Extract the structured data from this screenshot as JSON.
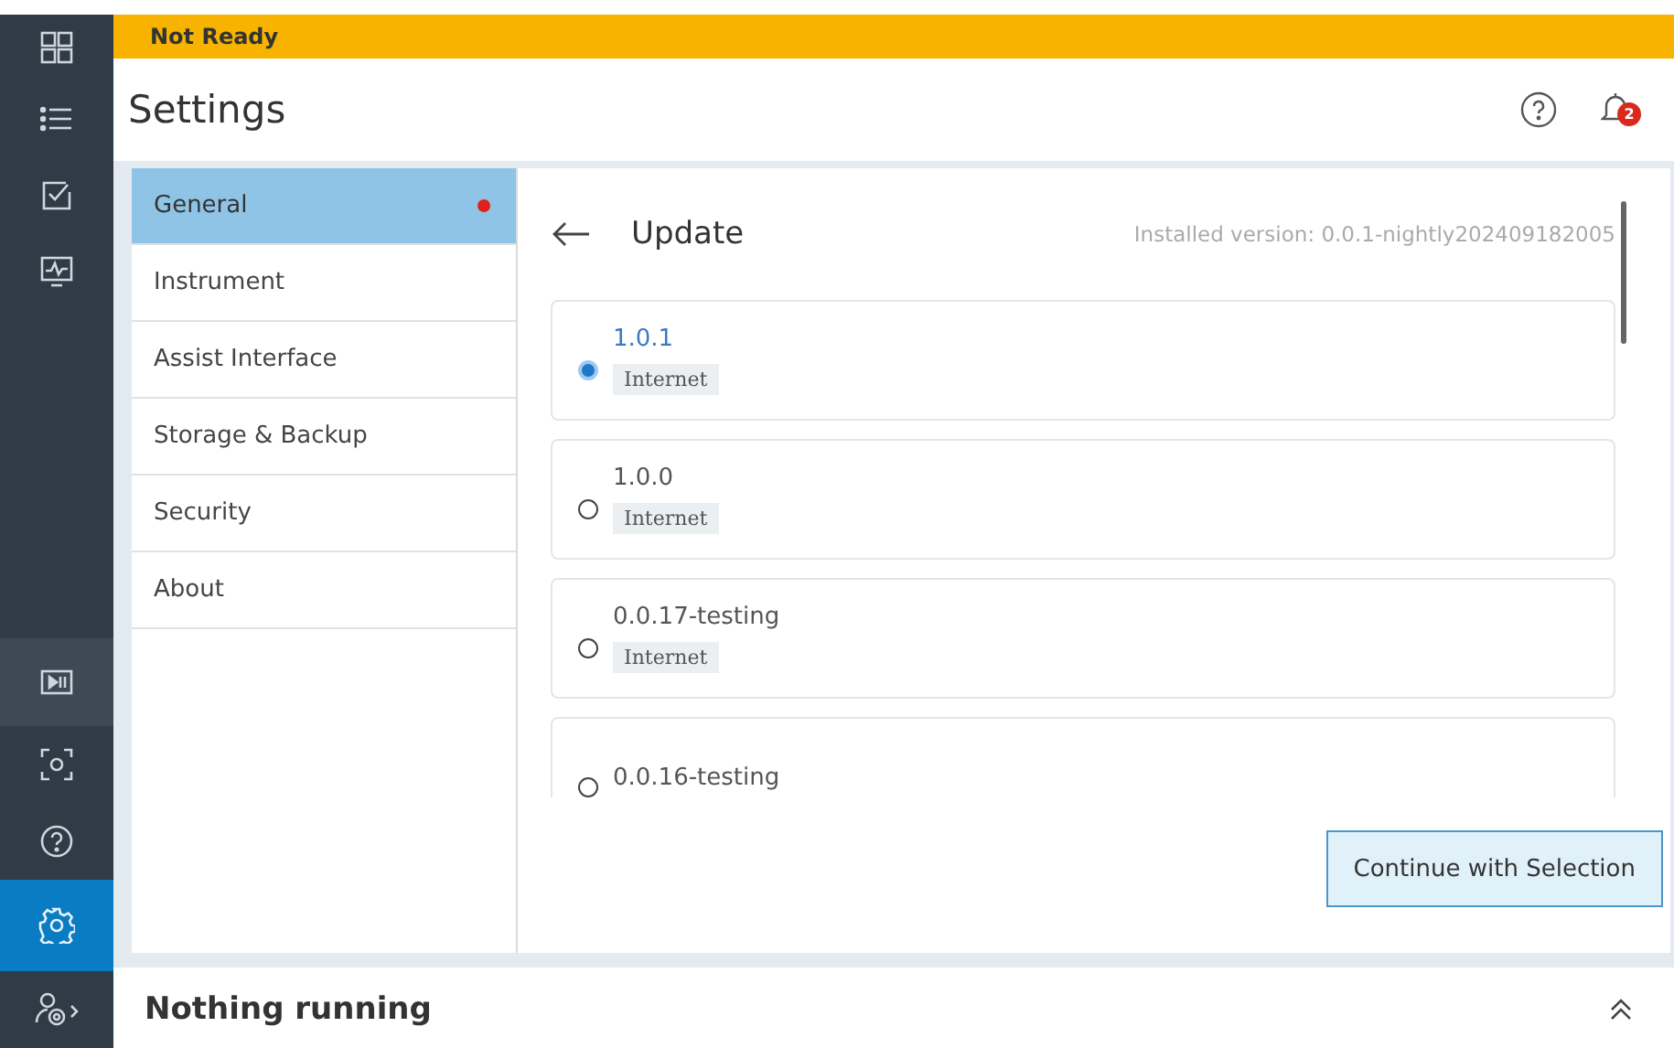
{
  "status_banner": {
    "text": "Not Ready"
  },
  "rail": [
    {
      "selected": false
    },
    {
      "selected": false
    },
    {
      "selected": false
    },
    {
      "selected": false
    },
    {
      "selected": false
    },
    {
      "selected": false
    },
    {
      "selected": false
    },
    {
      "selected": true
    },
    {
      "selected": false
    }
  ],
  "header": {
    "title": "Settings",
    "notification_count": "2"
  },
  "menu": [
    {
      "label": "General",
      "selected": true,
      "alert": true
    },
    {
      "label": "Instrument",
      "selected": false,
      "alert": false
    },
    {
      "label": "Assist Interface",
      "selected": false,
      "alert": false
    },
    {
      "label": "Storage & Backup",
      "selected": false,
      "alert": false
    },
    {
      "label": "Security",
      "selected": false,
      "alert": false
    },
    {
      "label": "About",
      "selected": false,
      "alert": false
    }
  ],
  "update": {
    "title": "Update",
    "installed": "Installed version: 0.0.1-nightly202409182005",
    "versions": [
      {
        "version": "1.0.1",
        "tag": "Internet",
        "selected": true
      },
      {
        "version": "1.0.0",
        "tag": "Internet",
        "selected": false
      },
      {
        "version": "0.0.17-testing",
        "tag": "Internet",
        "selected": false
      },
      {
        "version": "0.0.16-testing",
        "selected": false
      }
    ],
    "button": "Continue with Selection"
  },
  "footer": {
    "text": "Nothing running"
  }
}
